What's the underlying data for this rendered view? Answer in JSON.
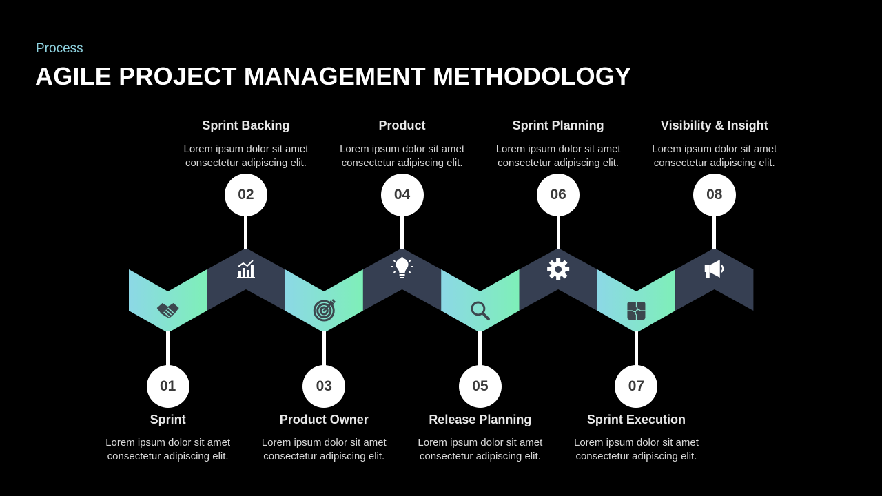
{
  "header": {
    "subtitle": "Process",
    "title": "AGILE PROJECT MANAGEMENT METHODOLOGY"
  },
  "colors": {
    "background": "#000000",
    "light_gradient_start": "#8cd8e6",
    "light_gradient_end": "#7eefb8",
    "dark_segment": "#363f52",
    "circle": "#ffffff",
    "number_text": "#3a3a3a",
    "subtitle": "#8fd3e0"
  },
  "steps": [
    {
      "number": "01",
      "title": "Sprint",
      "desc1": "Lorem ipsum dolor sit amet",
      "desc2": "consectetur  adipiscing elit.",
      "icon": "handshake-icon",
      "position": "bottom"
    },
    {
      "number": "02",
      "title": "Sprint Backing",
      "desc1": "Lorem ipsum dolor sit amet",
      "desc2": "consectetur  adipiscing elit.",
      "icon": "bar-chart-growth-icon",
      "position": "top"
    },
    {
      "number": "03",
      "title": "Product Owner",
      "desc1": "Lorem ipsum dolor sit amet",
      "desc2": "consectetur  adipiscing elit.",
      "icon": "target-icon",
      "position": "bottom"
    },
    {
      "number": "04",
      "title": "Product",
      "desc1": "Lorem ipsum dolor sit amet",
      "desc2": "consectetur  adipiscing elit.",
      "icon": "lightbulb-icon",
      "position": "top"
    },
    {
      "number": "05",
      "title": "Release Planning",
      "desc1": "Lorem ipsum dolor sit amet",
      "desc2": "consectetur  adipiscing elit.",
      "icon": "magnifier-icon",
      "position": "bottom"
    },
    {
      "number": "06",
      "title": "Sprint Planning",
      "desc1": "Lorem ipsum dolor sit amet",
      "desc2": "consectetur  adipiscing elit.",
      "icon": "gear-icon",
      "position": "top"
    },
    {
      "number": "07",
      "title": "Sprint Execution",
      "desc1": "Lorem ipsum dolor sit amet",
      "desc2": "consectetur  adipiscing elit.",
      "icon": "puzzle-icon",
      "position": "bottom"
    },
    {
      "number": "08",
      "title": "Visibility & Insight",
      "desc1": "Lorem ipsum dolor sit amet",
      "desc2": "consectetur  adipiscing elit.",
      "icon": "megaphone-icon",
      "position": "top"
    }
  ]
}
